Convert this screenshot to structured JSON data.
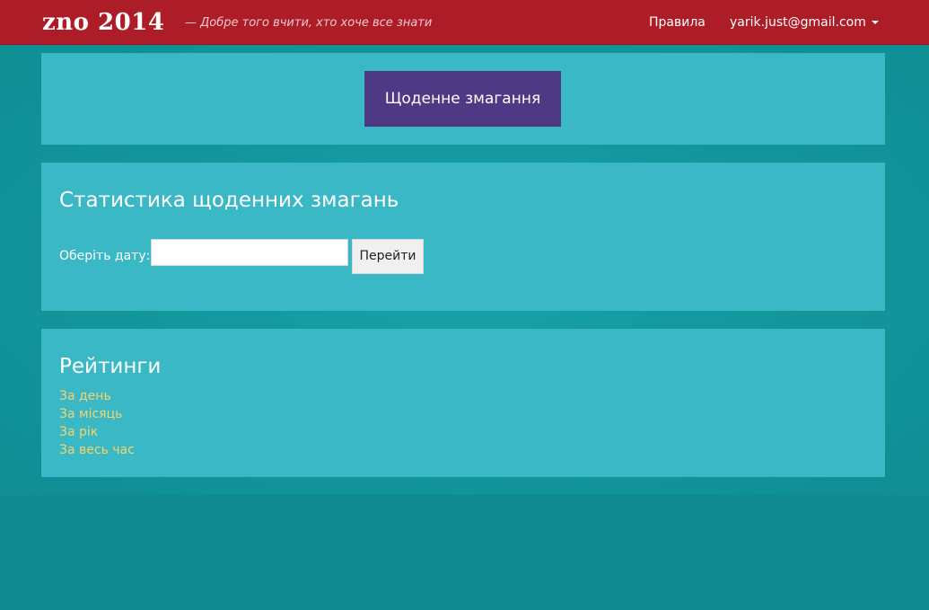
{
  "navbar": {
    "brand": "zno 2014",
    "tagline": "— Добре того вчити, хто хоче все знати",
    "rules_label": "Правила",
    "user_email": "yarik.just@gmail.com"
  },
  "daily": {
    "button_label": "Щоденне змагання"
  },
  "stats": {
    "title": "Статистика щоденних змагань",
    "date_label": "Оберіть дату:",
    "date_value": "",
    "go_label": "Перейти"
  },
  "ratings": {
    "title": "Рейтинги",
    "items": [
      {
        "label": "За день"
      },
      {
        "label": "За місяць"
      },
      {
        "label": "За рік"
      },
      {
        "label": "За весь час"
      }
    ]
  },
  "colors": {
    "navbar": "#ad1d27",
    "background": "#0f8a90",
    "panel": "#3ab8c6",
    "primary_button": "#4e3a84",
    "link": "#f6d46c"
  }
}
